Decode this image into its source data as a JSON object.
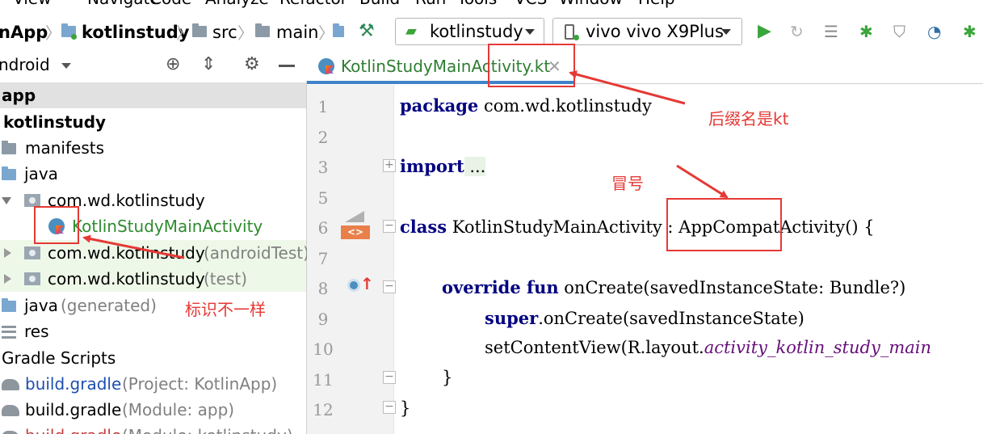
{
  "menu": [
    "View",
    "Navigate",
    "Code",
    "Analyze",
    "Refactor",
    "Build",
    "Run",
    "Tools",
    "VCS",
    "Window",
    "Help"
  ],
  "breadcrumb": {
    "project": "nApp",
    "module": "kotlinstudy",
    "src": "src",
    "main": "main"
  },
  "toolbar": {
    "run_config": "kotlinstudy",
    "device": "vivo vivo X9Plus"
  },
  "project_panel": {
    "view_mode": "ndroid",
    "tree": [
      {
        "label": "app"
      },
      {
        "label": "kotlinstudy"
      },
      {
        "label": "manifests"
      },
      {
        "label": "java"
      },
      {
        "label": "com.wd.kotlinstudy"
      },
      {
        "label": "KotlinStudyMainActivity"
      },
      {
        "label": "com.wd.kotlinstudy",
        "suffix": "(androidTest)"
      },
      {
        "label": "com.wd.kotlinstudy",
        "suffix": "(test)"
      },
      {
        "label": "java",
        "suffix": "(generated)"
      },
      {
        "label": "res"
      },
      {
        "label": "Gradle Scripts"
      },
      {
        "label": "build.gradle",
        "suffix": "(Project: KotlinApp)"
      },
      {
        "label": "build.gradle",
        "suffix": "(Module: app)"
      },
      {
        "label": "build.gradle",
        "suffix": "(Module: kotlinstudy)"
      }
    ]
  },
  "editor": {
    "tab_title": "KotlinStudyMainActivity.kt",
    "line_numbers": [
      "1",
      "2",
      "3",
      "5",
      "6",
      "7",
      "8",
      "9",
      "10",
      "11",
      "12"
    ],
    "code": {
      "l1_kw": "package",
      "l1_rest": " com.wd.kotlinstudy",
      "l3_kw": "import",
      "l3_dots": " ...",
      "l6_kw": "class",
      "l6_rest": " KotlinStudyMainActivity : AppCompatActivity() {",
      "l8_kw": "override fun",
      "l8_rest": " onCreate(savedInstanceState: Bundle?)",
      "l9_kw": "super",
      "l9_rest": ".onCreate(savedInstanceState)",
      "l10_a": "setContentView(R.layout.",
      "l10_b": "activity_kotlin_study_main",
      "l11": "}",
      "l12": "}"
    }
  },
  "annotations": {
    "suffix_note": "后缀名是kt",
    "colon_note": "冒号",
    "icon_note": "标识不一样"
  },
  "colors": {
    "annotation_red": "#e53935",
    "keyword_blue": "#000080",
    "tab_underline": "#4083c9"
  }
}
